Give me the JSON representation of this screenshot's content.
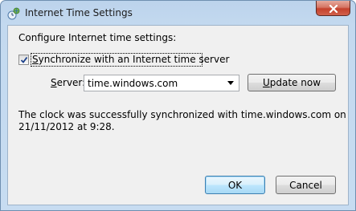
{
  "window": {
    "title": "Internet Time Settings",
    "icons": {
      "app": "clock-globe-icon",
      "close": "close-icon"
    }
  },
  "content": {
    "heading": "Configure Internet time settings:",
    "sync_checkbox": {
      "checked": true,
      "label_first": "S",
      "label_rest": "ynchronize with an Internet time server"
    },
    "server": {
      "label_first": "S",
      "label_rest": "erver:",
      "value": "time.windows.com"
    },
    "update_button": {
      "label_first": "U",
      "label_rest": "pdate now"
    },
    "status_line1": "The clock was successfully synchronized with time.windows.com on",
    "status_line2": "21/11/2012 at 9:28."
  },
  "buttons": {
    "ok": "OK",
    "cancel": "Cancel"
  },
  "colors": {
    "titlebar": "#c3d9ef",
    "close_button": "#c4412c",
    "client_bg": "#f0f0f0"
  }
}
